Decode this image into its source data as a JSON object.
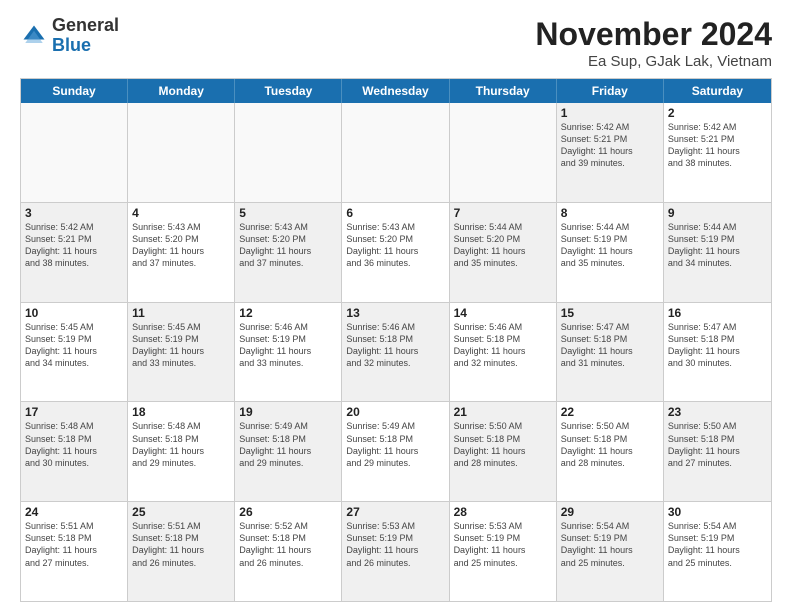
{
  "header": {
    "logo_general": "General",
    "logo_blue": "Blue",
    "month_title": "November 2024",
    "location": "Ea Sup, GJak Lak, Vietnam"
  },
  "weekdays": [
    "Sunday",
    "Monday",
    "Tuesday",
    "Wednesday",
    "Thursday",
    "Friday",
    "Saturday"
  ],
  "rows": [
    [
      {
        "day": "",
        "info": "",
        "empty": true
      },
      {
        "day": "",
        "info": "",
        "empty": true
      },
      {
        "day": "",
        "info": "",
        "empty": true
      },
      {
        "day": "",
        "info": "",
        "empty": true
      },
      {
        "day": "",
        "info": "",
        "empty": true
      },
      {
        "day": "1",
        "info": "Sunrise: 5:42 AM\nSunset: 5:21 PM\nDaylight: 11 hours\nand 39 minutes.",
        "shaded": true
      },
      {
        "day": "2",
        "info": "Sunrise: 5:42 AM\nSunset: 5:21 PM\nDaylight: 11 hours\nand 38 minutes.",
        "shaded": false
      }
    ],
    [
      {
        "day": "3",
        "info": "Sunrise: 5:42 AM\nSunset: 5:21 PM\nDaylight: 11 hours\nand 38 minutes.",
        "shaded": true
      },
      {
        "day": "4",
        "info": "Sunrise: 5:43 AM\nSunset: 5:20 PM\nDaylight: 11 hours\nand 37 minutes.",
        "shaded": false
      },
      {
        "day": "5",
        "info": "Sunrise: 5:43 AM\nSunset: 5:20 PM\nDaylight: 11 hours\nand 37 minutes.",
        "shaded": true
      },
      {
        "day": "6",
        "info": "Sunrise: 5:43 AM\nSunset: 5:20 PM\nDaylight: 11 hours\nand 36 minutes.",
        "shaded": false
      },
      {
        "day": "7",
        "info": "Sunrise: 5:44 AM\nSunset: 5:20 PM\nDaylight: 11 hours\nand 35 minutes.",
        "shaded": true
      },
      {
        "day": "8",
        "info": "Sunrise: 5:44 AM\nSunset: 5:19 PM\nDaylight: 11 hours\nand 35 minutes.",
        "shaded": false
      },
      {
        "day": "9",
        "info": "Sunrise: 5:44 AM\nSunset: 5:19 PM\nDaylight: 11 hours\nand 34 minutes.",
        "shaded": true
      }
    ],
    [
      {
        "day": "10",
        "info": "Sunrise: 5:45 AM\nSunset: 5:19 PM\nDaylight: 11 hours\nand 34 minutes.",
        "shaded": false
      },
      {
        "day": "11",
        "info": "Sunrise: 5:45 AM\nSunset: 5:19 PM\nDaylight: 11 hours\nand 33 minutes.",
        "shaded": true
      },
      {
        "day": "12",
        "info": "Sunrise: 5:46 AM\nSunset: 5:19 PM\nDaylight: 11 hours\nand 33 minutes.",
        "shaded": false
      },
      {
        "day": "13",
        "info": "Sunrise: 5:46 AM\nSunset: 5:18 PM\nDaylight: 11 hours\nand 32 minutes.",
        "shaded": true
      },
      {
        "day": "14",
        "info": "Sunrise: 5:46 AM\nSunset: 5:18 PM\nDaylight: 11 hours\nand 32 minutes.",
        "shaded": false
      },
      {
        "day": "15",
        "info": "Sunrise: 5:47 AM\nSunset: 5:18 PM\nDaylight: 11 hours\nand 31 minutes.",
        "shaded": true
      },
      {
        "day": "16",
        "info": "Sunrise: 5:47 AM\nSunset: 5:18 PM\nDaylight: 11 hours\nand 30 minutes.",
        "shaded": false
      }
    ],
    [
      {
        "day": "17",
        "info": "Sunrise: 5:48 AM\nSunset: 5:18 PM\nDaylight: 11 hours\nand 30 minutes.",
        "shaded": true
      },
      {
        "day": "18",
        "info": "Sunrise: 5:48 AM\nSunset: 5:18 PM\nDaylight: 11 hours\nand 29 minutes.",
        "shaded": false
      },
      {
        "day": "19",
        "info": "Sunrise: 5:49 AM\nSunset: 5:18 PM\nDaylight: 11 hours\nand 29 minutes.",
        "shaded": true
      },
      {
        "day": "20",
        "info": "Sunrise: 5:49 AM\nSunset: 5:18 PM\nDaylight: 11 hours\nand 29 minutes.",
        "shaded": false
      },
      {
        "day": "21",
        "info": "Sunrise: 5:50 AM\nSunset: 5:18 PM\nDaylight: 11 hours\nand 28 minutes.",
        "shaded": true
      },
      {
        "day": "22",
        "info": "Sunrise: 5:50 AM\nSunset: 5:18 PM\nDaylight: 11 hours\nand 28 minutes.",
        "shaded": false
      },
      {
        "day": "23",
        "info": "Sunrise: 5:50 AM\nSunset: 5:18 PM\nDaylight: 11 hours\nand 27 minutes.",
        "shaded": true
      }
    ],
    [
      {
        "day": "24",
        "info": "Sunrise: 5:51 AM\nSunset: 5:18 PM\nDaylight: 11 hours\nand 27 minutes.",
        "shaded": false
      },
      {
        "day": "25",
        "info": "Sunrise: 5:51 AM\nSunset: 5:18 PM\nDaylight: 11 hours\nand 26 minutes.",
        "shaded": true
      },
      {
        "day": "26",
        "info": "Sunrise: 5:52 AM\nSunset: 5:18 PM\nDaylight: 11 hours\nand 26 minutes.",
        "shaded": false
      },
      {
        "day": "27",
        "info": "Sunrise: 5:53 AM\nSunset: 5:19 PM\nDaylight: 11 hours\nand 26 minutes.",
        "shaded": true
      },
      {
        "day": "28",
        "info": "Sunrise: 5:53 AM\nSunset: 5:19 PM\nDaylight: 11 hours\nand 25 minutes.",
        "shaded": false
      },
      {
        "day": "29",
        "info": "Sunrise: 5:54 AM\nSunset: 5:19 PM\nDaylight: 11 hours\nand 25 minutes.",
        "shaded": true
      },
      {
        "day": "30",
        "info": "Sunrise: 5:54 AM\nSunset: 5:19 PM\nDaylight: 11 hours\nand 25 minutes.",
        "shaded": false
      }
    ]
  ]
}
